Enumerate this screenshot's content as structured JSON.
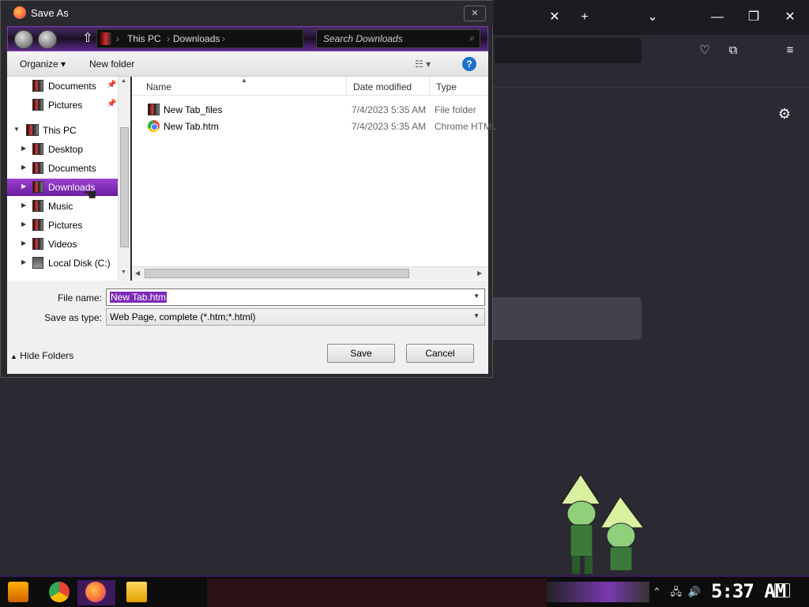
{
  "dialog": {
    "title": "Save As",
    "close_label": "✕",
    "address": {
      "crumbs": [
        "This PC",
        "Downloads"
      ],
      "search_placeholder": "Search Downloads"
    },
    "toolbar": {
      "organize": "Organize ▾",
      "new_folder": "New folder",
      "view": "☷ ▾",
      "help": "?"
    },
    "nav": [
      {
        "label": "Documents",
        "pinned": true
      },
      {
        "label": "Pictures",
        "pinned": true
      },
      {
        "label": "This PC"
      },
      {
        "label": "Desktop"
      },
      {
        "label": "Documents"
      },
      {
        "label": "Downloads",
        "selected": true
      },
      {
        "label": "Music"
      },
      {
        "label": "Pictures"
      },
      {
        "label": "Videos"
      },
      {
        "label": "Local Disk (C:)"
      }
    ],
    "columns": [
      "Name",
      "Date modified",
      "Type"
    ],
    "files": [
      {
        "name": "New Tab_files",
        "date": "7/4/2023 5:35 AM",
        "type": "File folder",
        "icon": "folder-icon"
      },
      {
        "name": "New Tab.htm",
        "date": "7/4/2023 5:35 AM",
        "type": "Chrome HTML",
        "icon": "chrome-icon"
      }
    ],
    "file_name_label": "File name:",
    "file_name_value": "New Tab.htm",
    "save_type_label": "Save as type:",
    "save_type_value": "Web Page, complete (*.htm;*.html)",
    "save_button": "Save",
    "cancel_button": "Cancel",
    "hide_folders": "Hide Folders"
  },
  "taskbar": {
    "clock": "5:37 AM"
  },
  "colors": {
    "accent": "#7d2ab8",
    "browser_bg": "#2b2a33"
  }
}
